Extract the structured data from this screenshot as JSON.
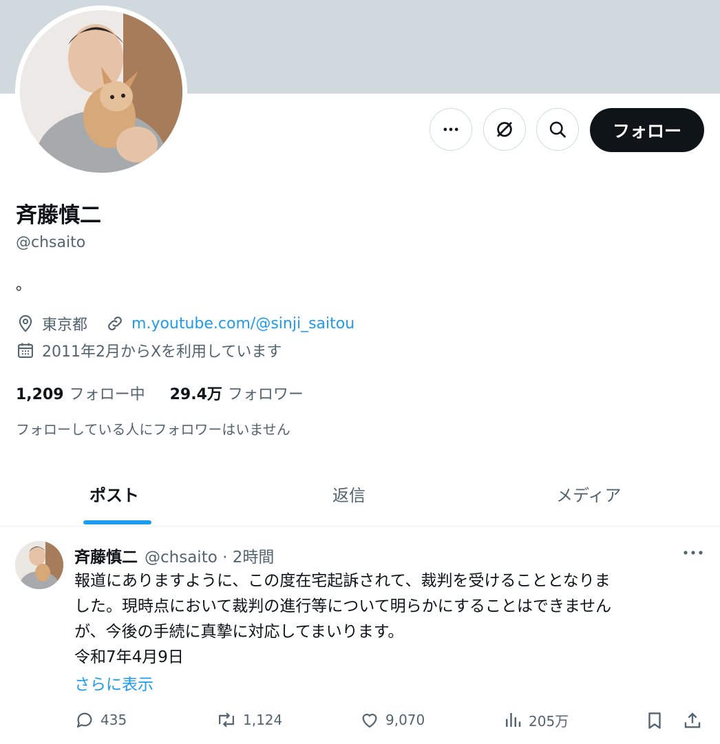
{
  "profile": {
    "name": "斉藤慎二",
    "handle": "@chsaito",
    "bio": "。",
    "location": "東京都",
    "link": "m.youtube.com/@sinji_saitou",
    "joined": "2011年2月からXを利用しています",
    "following_count": "1,209",
    "following_label": "フォロー中",
    "followers_count": "29.4万",
    "followers_label": "フォロワー",
    "mutual_note": "フォローしている人にフォロワーはいません"
  },
  "actions": {
    "follow_label": "フォロー",
    "more_icon": "more-horizontal-icon",
    "grok_icon": "grok-icon",
    "search_icon": "search-icon"
  },
  "tabs": [
    {
      "label": "ポスト",
      "active": true
    },
    {
      "label": "返信",
      "active": false
    },
    {
      "label": "メディア",
      "active": false
    }
  ],
  "post": {
    "author": "斉藤慎二",
    "handle_time": "@chsaito · 2時間",
    "lines": [
      "報道にありますように、この度在宅起訴されて、裁判を受けることとなりま",
      "した。現時点において裁判の進行等について明らかにすることはできません",
      "が、今後の手続に真摯に対応してまいります。",
      "令和7年4月9日"
    ],
    "show_more": "さらに表示",
    "replies": "435",
    "reposts": "1,124",
    "likes": "9,070",
    "views": "205万"
  },
  "colors": {
    "banner": "#cfd9de",
    "accent": "#1d9bf0",
    "text": "#0f1419",
    "secondary": "#536471"
  }
}
